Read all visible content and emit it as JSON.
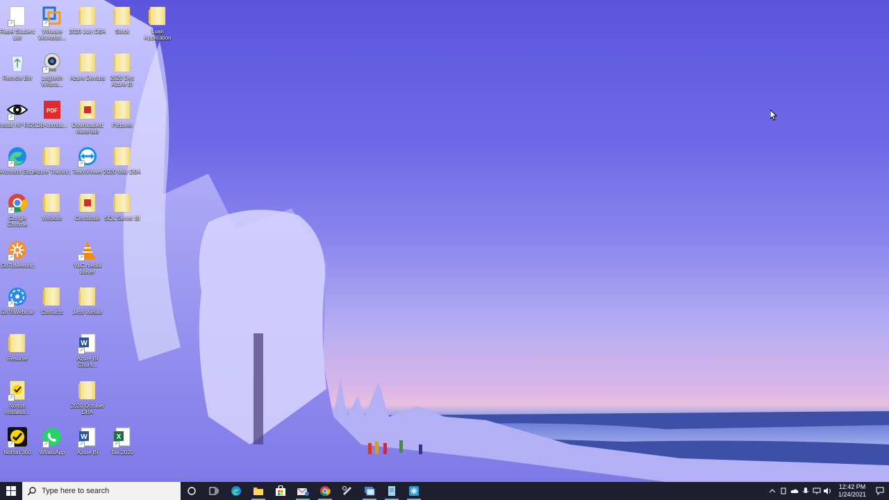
{
  "desktop": {
    "icons": [
      {
        "label": "Rasel Student List",
        "kind": "doc",
        "shortcut": true
      },
      {
        "label": "VMware Workstati...",
        "kind": "vmware",
        "shortcut": true
      },
      {
        "label": "2020 July DBA",
        "kind": "folder",
        "shortcut": false
      },
      {
        "label": "Stock",
        "kind": "folder",
        "shortcut": false
      },
      {
        "label": "Loan Application",
        "kind": "folder",
        "shortcut": false
      },
      {
        "label": "Recycle Bin",
        "kind": "recycle",
        "shortcut": false
      },
      {
        "label": "Logitech Webca...",
        "kind": "webcam",
        "shortcut": true
      },
      {
        "label": "Azure Devops",
        "kind": "folder",
        "shortcut": false
      },
      {
        "label": "2020 Dec Azure BI",
        "kind": "folder",
        "shortcut": false
      },
      {
        "label": "Install HP RGS",
        "kind": "eye",
        "shortcut": true
      },
      {
        "label": "DB-introdu...",
        "kind": "pdf",
        "shortcut": false
      },
      {
        "label": "Downloaded Materials",
        "kind": "folder-red",
        "shortcut": false
      },
      {
        "label": "Pictures",
        "kind": "folder",
        "shortcut": false
      },
      {
        "label": "Microsoft Edge",
        "kind": "edge",
        "shortcut": true
      },
      {
        "label": "Azure Training",
        "kind": "folder",
        "shortcut": false
      },
      {
        "label": "TeamViewer",
        "kind": "teamviewer",
        "shortcut": true
      },
      {
        "label": "2020 May DBA",
        "kind": "folder",
        "shortcut": false
      },
      {
        "label": "Google Chrome",
        "kind": "chrome",
        "shortcut": true
      },
      {
        "label": "Website",
        "kind": "folder",
        "shortcut": false
      },
      {
        "label": "Certificate",
        "kind": "folder-red",
        "shortcut": false
      },
      {
        "label": "SQL Server BI",
        "kind": "folder",
        "shortcut": false
      },
      {
        "label": "GoToMeeting",
        "kind": "gotomeeting",
        "shortcut": true
      },
      {
        "label": "VLC media player",
        "kind": "vlc",
        "shortcut": true
      },
      {
        "label": "GoToWebinar",
        "kind": "gotowebinar",
        "shortcut": true
      },
      {
        "label": "Contacts",
        "kind": "folder",
        "shortcut": false
      },
      {
        "label": "Jess Wesite",
        "kind": "folder",
        "shortcut": false
      },
      {
        "label": "Resume",
        "kind": "folder",
        "shortcut": false
      },
      {
        "label": "Azure BI Cours...",
        "kind": "word",
        "shortcut": true
      },
      {
        "label": "Norton Installati...",
        "kind": "norton",
        "shortcut": true
      },
      {
        "label": "2020 October DBA",
        "kind": "folder",
        "shortcut": false
      },
      {
        "label": "Norton 360",
        "kind": "norton360",
        "shortcut": true
      },
      {
        "label": "WhatsApp",
        "kind": "whatsapp",
        "shortcut": true
      },
      {
        "label": "Azure BI",
        "kind": "word",
        "shortcut": true
      },
      {
        "label": "Tax 2020",
        "kind": "excel",
        "shortcut": true
      }
    ]
  },
  "taskbar": {
    "search_placeholder": "Type here to search",
    "pinned": [
      {
        "name": "cortana-button",
        "icon": "circle-icon"
      },
      {
        "name": "task-view-button",
        "icon": "task-view-icon"
      },
      {
        "name": "edge-taskbar-button",
        "icon": "edge-icon"
      },
      {
        "name": "file-explorer-taskbar-button",
        "icon": "folder-icon"
      },
      {
        "name": "store-taskbar-button",
        "icon": "store-icon"
      },
      {
        "name": "mail-taskbar-button",
        "icon": "mail-icon"
      },
      {
        "name": "chrome-taskbar-button",
        "icon": "chrome-icon"
      },
      {
        "name": "snip-taskbar-button",
        "icon": "snip-icon"
      },
      {
        "name": "remote-desktop-taskbar-button",
        "icon": "remote-desktop-icon"
      },
      {
        "name": "notepad-taskbar-button",
        "icon": "notepad-icon"
      },
      {
        "name": "snowflake-taskbar-button",
        "icon": "snowflake-icon"
      }
    ],
    "clock_time": "12:42 PM",
    "clock_date": "1/24/2021"
  },
  "colors": {
    "taskbar_bg": "#1d1f2e",
    "accent": "#7aa7e8"
  }
}
